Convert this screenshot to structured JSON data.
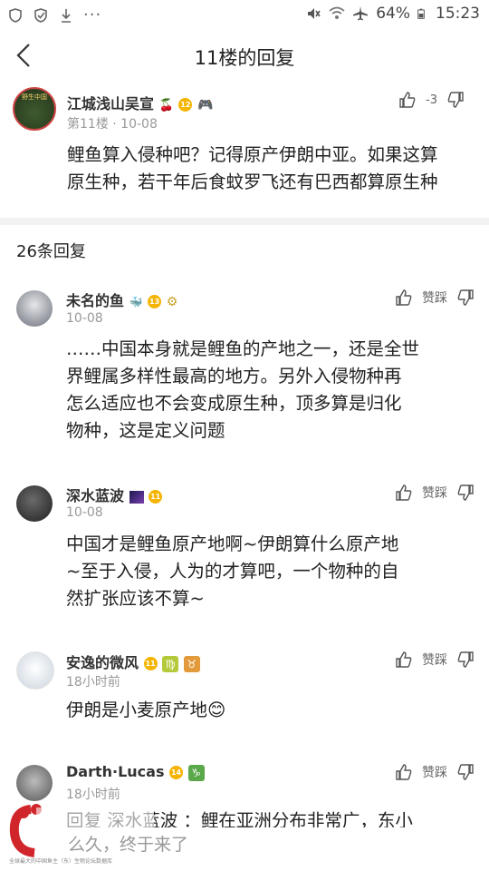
{
  "status_bar": {
    "battery": "64%",
    "time": "15:23"
  },
  "header": {
    "title": "11楼的回复"
  },
  "main_post": {
    "username": "江城浅山吴宣",
    "level": "12",
    "floor_date": "第11楼 · 10-08",
    "vote_count": "-3",
    "content_lines": [
      "鲤鱼算入侵种吧？记得原产伊朗中亚。如果这算",
      "原生种，若干年后食蚊罗飞还有巴西都算原生种"
    ]
  },
  "reply_count": "26条回复",
  "replies": [
    {
      "username": "未名的鱼",
      "level": "13",
      "time": "10-08",
      "vote_label": "赞踩",
      "content_lines": [
        "……中国本身就是鲤鱼的产地之一，还是全世",
        "界鲤属多样性最高的地方。另外入侵物种再",
        "怎么适应也不会变成原生种，顶多算是归化",
        "物种，这是定义问题"
      ]
    },
    {
      "username": "深水蓝波",
      "level": "11",
      "time": "10-08",
      "vote_label": "赞踩",
      "content_lines": [
        "中国才是鲤鱼原产地啊~伊朗算什么原产地",
        "~至于入侵，人为的才算吧，一个物种的自",
        "然扩张应该不算~"
      ]
    },
    {
      "username": "安逸的微风",
      "level": "11",
      "zodiac1": "♍",
      "zodiac2": "♉",
      "time": "18小时前",
      "vote_label": "赞踩",
      "content_lines": [
        "伊朗是小麦原产地😊"
      ]
    },
    {
      "username": "Darth·Lucas",
      "level": "14",
      "zodiac1": "♑",
      "time": "18小时前",
      "vote_label": "赞踩",
      "content_lines": [
        "回复 深水蓝波 ：鲤在亚洲分布非常广，东小"
      ]
    }
  ],
  "footer": {
    "text": "么久，终于来了",
    "small": "全球最大的中国鱼主（东）生物论坛数据库"
  },
  "colors": {
    "accent": "#f4b400",
    "link": "#4a90d9",
    "logo_red": "#d0262b"
  }
}
